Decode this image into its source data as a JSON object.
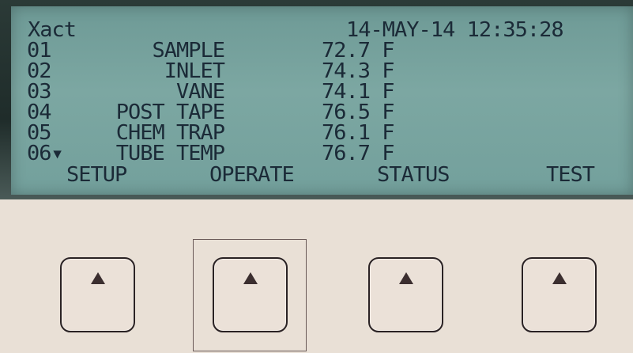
{
  "display": {
    "title": "Xact",
    "date": "14-MAY-14",
    "time": "12:35:28",
    "rows": [
      {
        "channel": "01",
        "name": "SAMPLE",
        "value": "72.7",
        "unit": "F"
      },
      {
        "channel": "02",
        "name": "INLET",
        "value": "74.3",
        "unit": "F"
      },
      {
        "channel": "03",
        "name": "VANE",
        "value": "74.1",
        "unit": "F"
      },
      {
        "channel": "04",
        "name": "POST TAPE",
        "value": "76.5",
        "unit": "F"
      },
      {
        "channel": "05",
        "name": "CHEM TRAP",
        "value": "76.1",
        "unit": "F"
      },
      {
        "channel": "06▾",
        "name": "TUBE TEMP",
        "value": "76.7",
        "unit": "F"
      }
    ],
    "softkeys": [
      "SETUP",
      "OPERATE",
      "STATUS",
      "TEST"
    ]
  },
  "keys": {
    "icon": "up-triangle-icon",
    "highlighted_index": 1
  },
  "colors": {
    "lcd_background": "#7ca7a2",
    "lcd_text": "#1b2a37",
    "panel": "#e9e0d6",
    "key_border": "#2a2224"
  }
}
